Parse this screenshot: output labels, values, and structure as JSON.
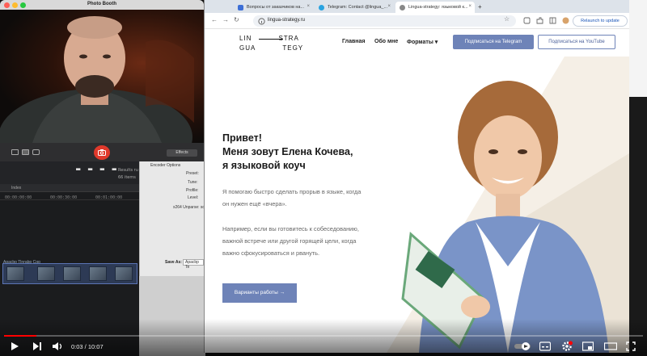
{
  "photo_booth": {
    "title": "Photo Booth",
    "effects_label": "Effects"
  },
  "editor": {
    "film_text": "",
    "meta_line1": "Results ru",
    "meta_line2": "66 items",
    "timeline_label": "Index",
    "timecodes": [
      "00:00:00:00",
      "00:00:30:00",
      "00:01:00:00"
    ],
    "clip_label": "Apacbp Tlnrabp Cqq"
  },
  "export_dialog": {
    "rows": [
      "Encoder Options",
      "Preset:",
      "Tune:",
      "Profile:",
      "Level:",
      "x264 Unparse: sc"
    ],
    "save_as_label": "Save As:",
    "save_as_value": "Apacbp Te"
  },
  "browser": {
    "tabs": [
      {
        "label": "Вопросы от заказчиков на...",
        "active": false
      },
      {
        "label": "Telegram: Contact @lingua_...",
        "active": false
      },
      {
        "label": "Lingua-strategy: языковой к...",
        "active": true
      }
    ],
    "url": "lingua-strategy.ru",
    "relaunch_label": "Relaunch to update"
  },
  "site": {
    "logo": {
      "line1_left": "LIN",
      "line1_right": "STRA",
      "line2_left": "GUA",
      "line2_right": "TEGY"
    },
    "nav": [
      "Главная",
      "Обо мне",
      "Форматы ▾"
    ],
    "btn_telegram": "Подписаться на Telegram",
    "btn_youtube": "Подписаться на YouTube",
    "hero": {
      "title_line1": "Привет!",
      "title_line2": "Меня зовут Елена Кочева,",
      "title_line3": "я языковой коуч",
      "p1_line1": "Я помогаю быстро сделать прорыв в языке, когда",
      "p1_line2": "он нужен ещё «вчера».",
      "p2_line1": "Например, если вы готовитесь к собеседованию,",
      "p2_line2": "важной встрече или другой горящей цели, когда",
      "p2_line3": "важно сфокусироваться и рвануть.",
      "cta": "Варианты работы →"
    }
  },
  "player": {
    "time": "0:03 / 10:07",
    "progress": 0.005,
    "accent": "#ff0000"
  },
  "colors": {
    "brand_blue": "#6e83b8",
    "shutter_red": "#e0392b"
  }
}
